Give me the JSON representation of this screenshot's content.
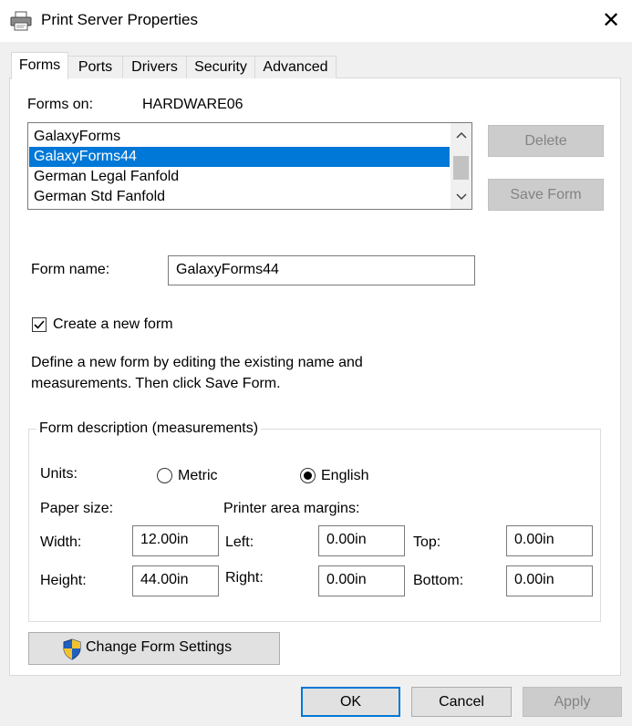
{
  "window": {
    "title": "Print Server Properties",
    "close_glyph": "✕",
    "icon": "printer-icon"
  },
  "tabs": [
    {
      "label": "Forms",
      "active": true
    },
    {
      "label": "Ports",
      "active": false
    },
    {
      "label": "Drivers",
      "active": false
    },
    {
      "label": "Security",
      "active": false
    },
    {
      "label": "Advanced",
      "active": false
    }
  ],
  "forms_on": {
    "label": "Forms on:",
    "server": "HARDWARE06"
  },
  "forms_list": {
    "items": [
      "GalaxyForms",
      "GalaxyForms44",
      "German Legal Fanfold",
      "German Std Fanfold"
    ],
    "selected": "GalaxyForms44",
    "scroll_up_glyph": "⌃",
    "scroll_down_glyph": "⌄"
  },
  "buttons": {
    "delete": "Delete",
    "save_form": "Save Form",
    "change_form_settings": "Change Form Settings",
    "ok": "OK",
    "cancel": "Cancel",
    "apply": "Apply"
  },
  "form_name": {
    "label": "Form name:",
    "value": "GalaxyForms44"
  },
  "create_new_form": {
    "label": "Create a new form",
    "checked": true,
    "check_glyph": "✓"
  },
  "description": {
    "line1": "Define a new form by editing the existing name and",
    "line2": "measurements. Then click Save Form."
  },
  "measurements": {
    "group_title": "Form description (measurements)",
    "units_label": "Units:",
    "unit_options": [
      {
        "label": "Metric",
        "selected": false
      },
      {
        "label": "English",
        "selected": true
      }
    ],
    "paper_size_label": "Paper size:",
    "printer_area_label": "Printer area margins:",
    "width": {
      "label": "Width:",
      "value": "12.00in"
    },
    "height": {
      "label": "Height:",
      "value": "44.00in"
    },
    "left": {
      "label": "Left:",
      "value": "0.00in"
    },
    "right": {
      "label": "Right:",
      "value": "0.00in"
    },
    "top": {
      "label": "Top:",
      "value": "0.00in"
    },
    "bottom": {
      "label": "Bottom:",
      "value": "0.00in"
    }
  },
  "colors": {
    "selection": "#0078d7",
    "window_bg": "#f0f0f0",
    "shield_blue": "#1f5fbf",
    "shield_yellow": "#f2c12e"
  }
}
